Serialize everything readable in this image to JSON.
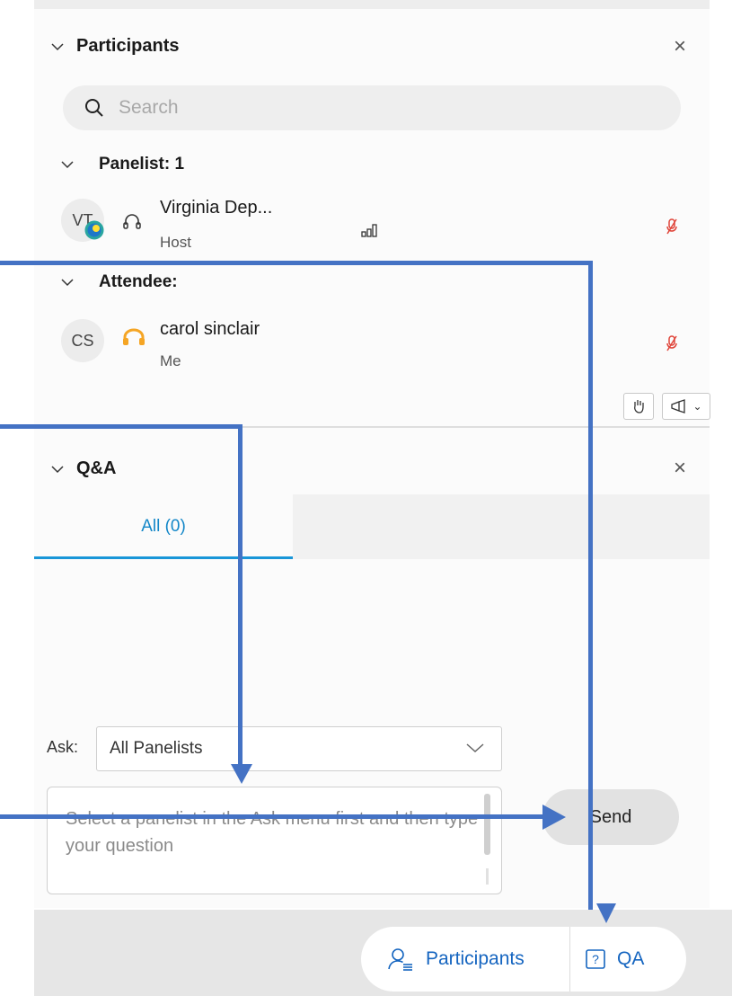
{
  "participants": {
    "title": "Participants",
    "search_placeholder": "Search",
    "groups": [
      {
        "label": "Panelist: 1",
        "members": [
          {
            "initials": "VT",
            "name": "Virginia Dep...",
            "role": "Host"
          }
        ]
      },
      {
        "label": "Attendee:",
        "members": [
          {
            "initials": "CS",
            "name": "carol sinclair",
            "role": "Me"
          }
        ]
      }
    ]
  },
  "qa": {
    "title": "Q&A",
    "tabs": [
      {
        "label": "All (0)"
      }
    ],
    "ask_label": "Ask:",
    "ask_selected": "All Panelists",
    "question_placeholder": "Select a panelist in the Ask menu first and then type your question",
    "send_label": "Send"
  },
  "bottom_bar": {
    "participants_label": "Participants",
    "qa_label": "QA"
  },
  "colors": {
    "accent_blue": "#1387c8",
    "annotation_arrow": "#4472c4",
    "muted_red": "#e0453a",
    "headset_orange": "#f5a524"
  }
}
